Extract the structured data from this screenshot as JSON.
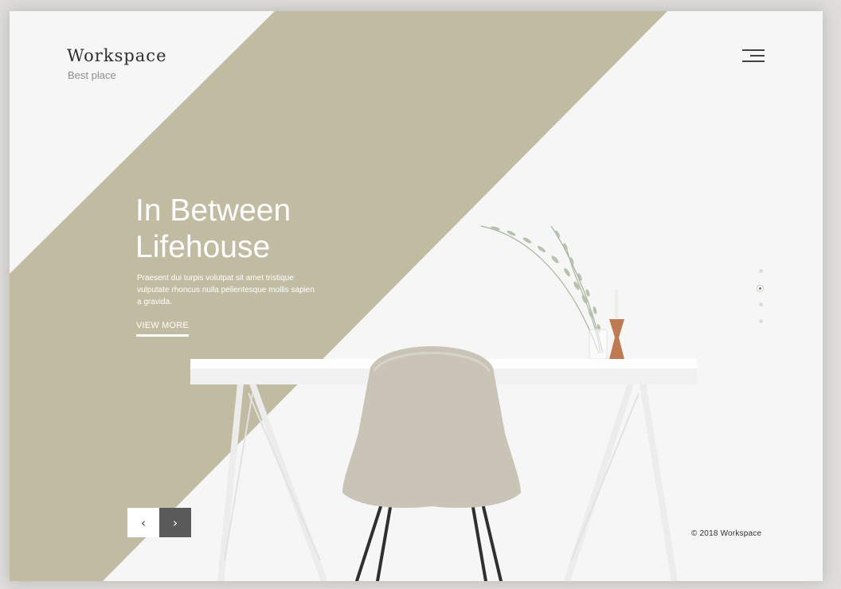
{
  "brand": {
    "name": "Workspace",
    "tagline": "Best place"
  },
  "header": {
    "menu_icon": "hamburger-menu-icon"
  },
  "hero": {
    "title_line1": "In Between",
    "title_line2": "Lifehouse",
    "description": "Praesent dui turpis volutpat sit amet tristique vulputate rhoncus nulla pellentesque mollis sapien a gravida.",
    "cta_label": "VIEW MORE"
  },
  "slider": {
    "prev_icon": "chevron-left-icon",
    "next_icon": "chevron-right-icon",
    "prev_glyph": "‹",
    "next_glyph": "›",
    "dots_count": 4,
    "active_dot": 2
  },
  "footer": {
    "copyright": "© 2018 Workspace"
  },
  "colors": {
    "accent_band": "#c1bba1",
    "background": "#f6f6f6",
    "chair": "#c9c4b6",
    "vase": "#c07a52",
    "dark_button": "#5a5a5a"
  }
}
